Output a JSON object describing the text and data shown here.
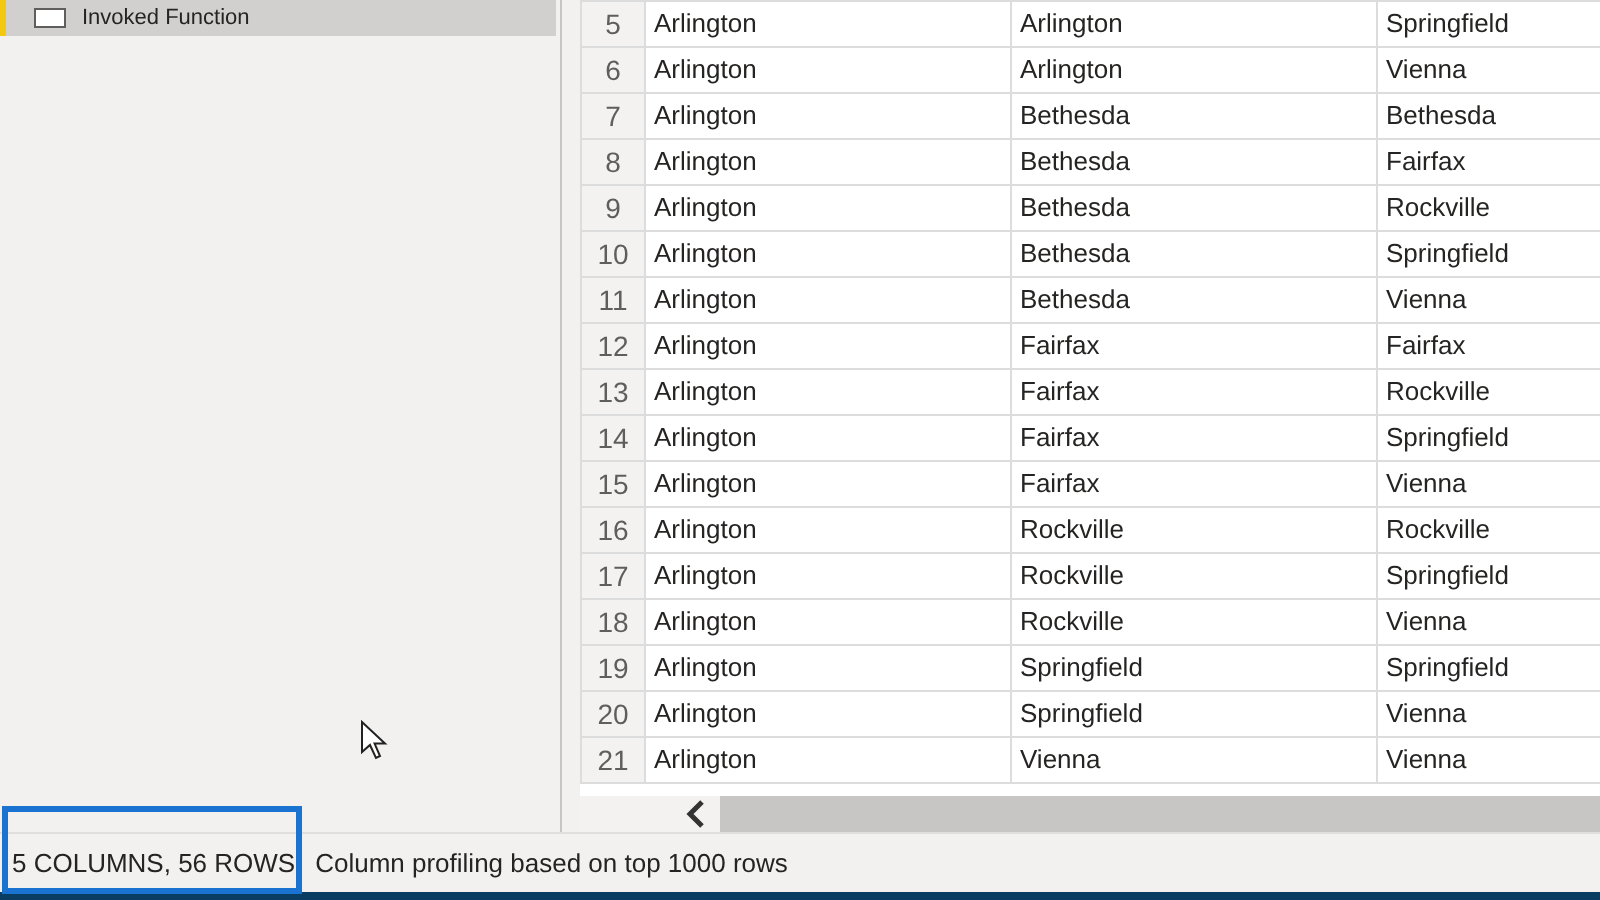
{
  "sidebar": {
    "items": [
      {
        "label": "Invoked Function",
        "selected": true
      }
    ]
  },
  "table": {
    "rows": [
      {
        "number": "5",
        "cells": [
          "Arlington",
          "Arlington",
          "Springfield"
        ]
      },
      {
        "number": "6",
        "cells": [
          "Arlington",
          "Arlington",
          "Vienna"
        ]
      },
      {
        "number": "7",
        "cells": [
          "Arlington",
          "Bethesda",
          "Bethesda"
        ]
      },
      {
        "number": "8",
        "cells": [
          "Arlington",
          "Bethesda",
          "Fairfax"
        ]
      },
      {
        "number": "9",
        "cells": [
          "Arlington",
          "Bethesda",
          "Rockville"
        ]
      },
      {
        "number": "10",
        "cells": [
          "Arlington",
          "Bethesda",
          "Springfield"
        ]
      },
      {
        "number": "11",
        "cells": [
          "Arlington",
          "Bethesda",
          "Vienna"
        ]
      },
      {
        "number": "12",
        "cells": [
          "Arlington",
          "Fairfax",
          "Fairfax"
        ]
      },
      {
        "number": "13",
        "cells": [
          "Arlington",
          "Fairfax",
          "Rockville"
        ]
      },
      {
        "number": "14",
        "cells": [
          "Arlington",
          "Fairfax",
          "Springfield"
        ]
      },
      {
        "number": "15",
        "cells": [
          "Arlington",
          "Fairfax",
          "Vienna"
        ]
      },
      {
        "number": "16",
        "cells": [
          "Arlington",
          "Rockville",
          "Rockville"
        ]
      },
      {
        "number": "17",
        "cells": [
          "Arlington",
          "Rockville",
          "Springfield"
        ]
      },
      {
        "number": "18",
        "cells": [
          "Arlington",
          "Rockville",
          "Vienna"
        ]
      },
      {
        "number": "19",
        "cells": [
          "Arlington",
          "Springfield",
          "Springfield"
        ]
      },
      {
        "number": "20",
        "cells": [
          "Arlington",
          "Springfield",
          "Vienna"
        ]
      },
      {
        "number": "21",
        "cells": [
          "Arlington",
          "Vienna",
          "Vienna"
        ]
      }
    ]
  },
  "status_bar": {
    "summary": "5 COLUMNS, 56 ROWS",
    "summary_highlighted": true,
    "profiling": "Column profiling based on top 1000 rows"
  }
}
